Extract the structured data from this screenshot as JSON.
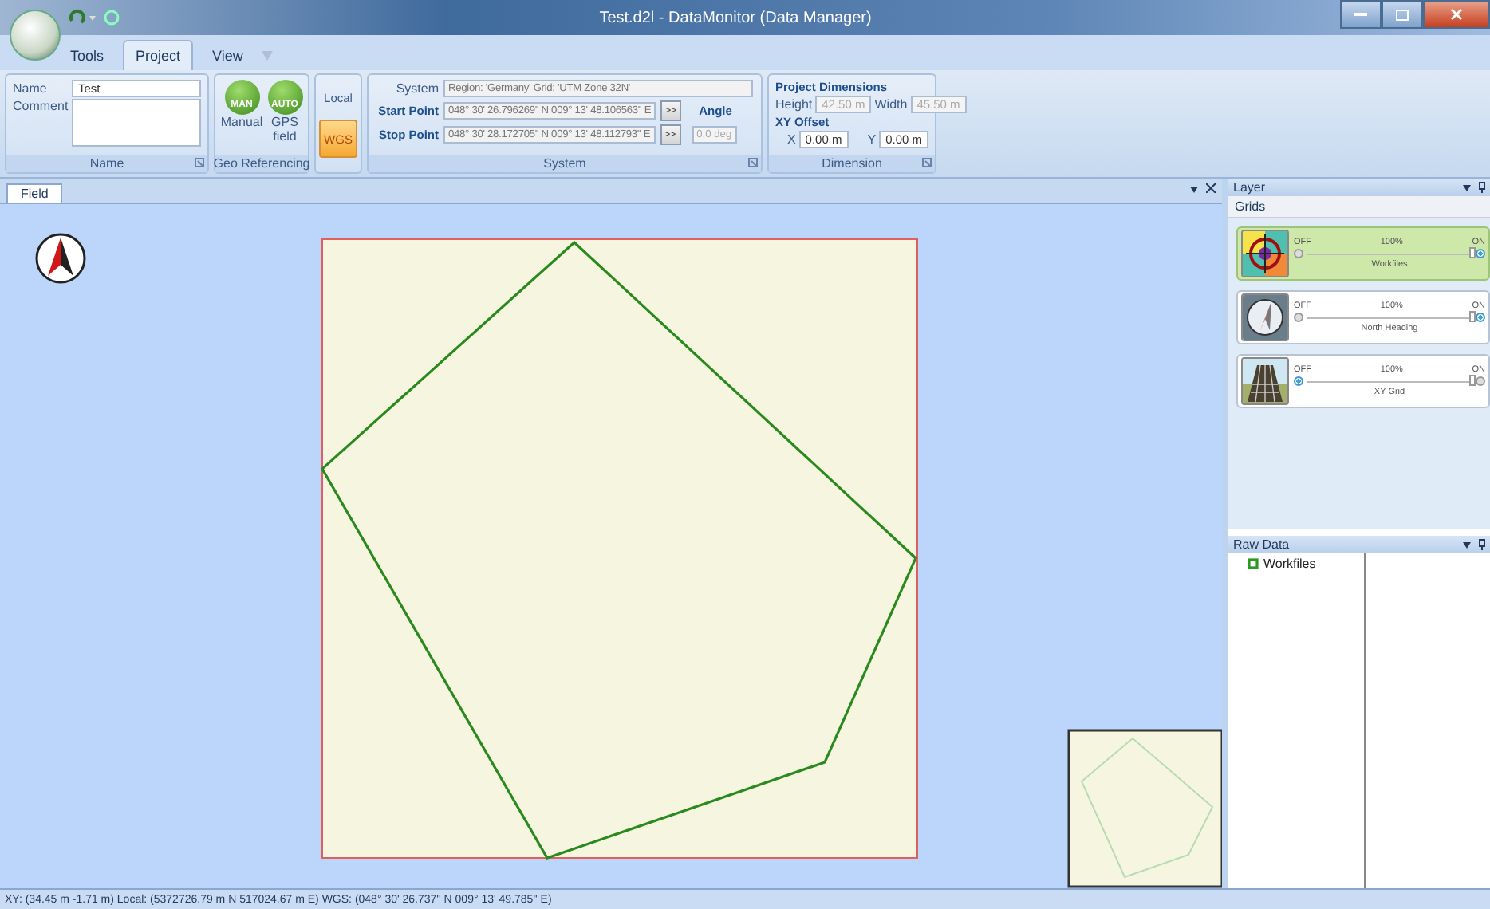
{
  "window": {
    "title": "Test.d2l - DataMonitor (Data Manager)"
  },
  "tabs": [
    {
      "label": "Tools",
      "selected": false
    },
    {
      "label": "Project",
      "selected": true
    },
    {
      "label": "View",
      "selected": false
    }
  ],
  "ribbon": {
    "name_group": {
      "caption": "Name",
      "name_label": "Name",
      "name_value": "Test",
      "comment_label": "Comment"
    },
    "geo_group": {
      "caption": "Geo Referencing",
      "buttons": [
        {
          "badge": "MAN",
          "label": "Manual"
        },
        {
          "badge": "AUTO",
          "label": "GPS field"
        }
      ]
    },
    "coord_modes": [
      {
        "label": "Local",
        "selected": false
      },
      {
        "label": "WGS",
        "selected": true
      }
    ],
    "system_group": {
      "caption": "System",
      "system_label": "System",
      "system_value": "Region: 'Germany'   Grid: 'UTM Zone 32N'",
      "start_label": "Start Point",
      "start_value": "048° 30' 26.796269'' N 009° 13' 48.106563'' E",
      "stop_label": "Stop Point",
      "stop_value": "048° 30' 28.172705'' N 009° 13' 48.112793'' E",
      "arrow_button": ">>",
      "angle_label": "Angle",
      "angle_value": "0.0 deg",
      "angle_disabled": true
    },
    "dimension_group": {
      "caption": "Dimension",
      "title": "Project Dimensions",
      "height_label": "Height",
      "height_value": "42.50 m",
      "width_label": "Width",
      "width_value": "45.50 m",
      "size_disabled": true,
      "offset_title": "XY Offset",
      "x_label": "X",
      "x_value": "0.00 m",
      "y_label": "Y",
      "y_value": "0.00 m"
    }
  },
  "document_tabs": [
    {
      "label": "Field",
      "selected": true
    }
  ],
  "layer_panel": {
    "title": "Layer",
    "section": "Grids",
    "layers": [
      {
        "name": "Workfiles",
        "kind": "target",
        "percent": "100%",
        "off_label": "OFF",
        "on_label": "ON",
        "on": true,
        "selected": true,
        "level": 1
      },
      {
        "name": "North Heading",
        "kind": "compass",
        "percent": "100%",
        "off_label": "OFF",
        "on_label": "ON",
        "on": true,
        "selected": false,
        "level": 1
      },
      {
        "name": "XY Grid",
        "kind": "grid",
        "percent": "100%",
        "off_label": "OFF",
        "on_label": "ON",
        "on": false,
        "selected": false,
        "level": 1
      }
    ]
  },
  "raw_data_panel": {
    "title": "Raw Data",
    "items": [
      {
        "label": "Workfiles"
      }
    ]
  },
  "status_bar": "XY: (34.45 m  -1.71 m)   Local: (5372726.79 m N  517024.67 m E)   WGS: (048° 30' 26.737'' N 009° 13' 49.785'' E)"
}
